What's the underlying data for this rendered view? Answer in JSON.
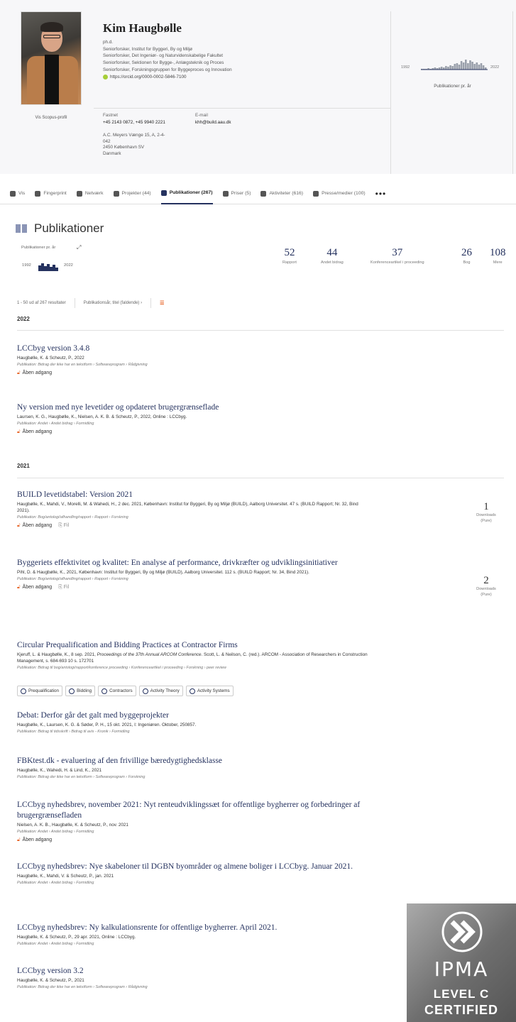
{
  "profile": {
    "name": "Kim Haugbølle",
    "degree": "ph.d.",
    "titles": [
      "Seniorforsker, Institut for Byggeri, By og Miljø",
      "Seniorforsker, Det Ingeniør- og Naturvidenskabelige Fakultet",
      "Seniorforsker, Sektionen for Bygge-, Anlægsteknik og Proces",
      "Seniorforsker, Forskningsgruppen for Byggeproces og Innovation"
    ],
    "orcid": "https://orcid.org/0000-0002-5846-7100",
    "scopus_link": "Vis Scopus-profil",
    "phone_label": "Fastnet",
    "phone_value": "+45 2143 0872, +45 9940 2221",
    "email_label": "E-mail",
    "email_value": "khh@build.aau.dk",
    "address": [
      "A.C. Meyers Vænge 15, A, 2-4-",
      "042",
      "2450 København SV",
      "Danmark"
    ],
    "chart_start": "1992",
    "chart_end": "2022",
    "chart_label": "Publikationer pr. år"
  },
  "tabs": [
    {
      "label": "Vis",
      "icon": "person-icon",
      "active": false
    },
    {
      "label": "Fingerprint",
      "icon": "fingerprint-icon",
      "active": false
    },
    {
      "label": "Netværk",
      "icon": "network-icon",
      "active": false
    },
    {
      "label": "Projekter (44)",
      "icon": "projects-icon",
      "active": false
    },
    {
      "label": "Publikationer (267)",
      "icon": "book-icon",
      "active": true
    },
    {
      "label": "Priser (5)",
      "icon": "trophy-icon",
      "active": false
    },
    {
      "label": "Aktiviteter (616)",
      "icon": "briefcase-icon",
      "active": false
    },
    {
      "label": "Presse/medier (100)",
      "icon": "newspaper-icon",
      "active": false
    }
  ],
  "tabs_more": "•••",
  "publications": {
    "heading": "Publikationer",
    "mini_label": "Publikationer pr. år",
    "mini_start": "1992",
    "mini_end": "2022",
    "stats": [
      {
        "n": "52",
        "label": "Rapport"
      },
      {
        "n": "44",
        "label": "Andet bidrag"
      },
      {
        "n": "37",
        "label": "Konferenceartikel i proceeding"
      },
      {
        "n": "26",
        "label": "Bog"
      },
      {
        "n": "108",
        "label": "Mere"
      }
    ],
    "results": "1 - 50 ud af 267 resultater",
    "sort": "Publikationsår, titel (faldende) ›",
    "rss": "RSS",
    "year_2022": "2022",
    "year_2021": "2021"
  },
  "items": [
    {
      "title": "LCCbyg version 3.4.8",
      "authors": "Haugbølle, K. & Scheutz, P., 2022",
      "category": "Publikation: Bidrag der ikke har en tekstform › Softwareprogram › Rådgivning",
      "access": "Åben adgang"
    },
    {
      "title": "Ny version med nye levetider og opdateret brugergrænseflade",
      "authors": "Laursen, K. G., Haugbølle, K., Nielsen, A. K. B. & Scheutz, P., 2022, Online : LCCbyg.",
      "category": "Publikation: Andet › Andet bidrag › Formidling",
      "access": "Åben adgang"
    },
    {
      "title": "BUILD levetidstabel: Version 2021",
      "authors": "Haugbølle, K., Mahdi, V., Morelli, M. & Wahedi, H., 2 dec. 2021, København: Institut for Byggeri, By og Miljø (BUILD), Aalborg Universitet. 47 s. (BUILD Rapport; Nr. 32, Bind 2021).",
      "category": "Publikation: Bog/antologi/afhandling/rapport › Rapport › Forskning",
      "access": "Åben adgang",
      "file": "Fil",
      "downloads": "1",
      "downloads_label": "Downloads",
      "downloads_src": "(Pure)"
    },
    {
      "title": "Byggeriets effektivitet og kvalitet: En analyse af performance, drivkræfter og udviklingsinitiativer",
      "authors": "Pihl, D. & Haugbølle, K., 2021, København: Institut for Byggeri, By og Miljø (BUILD), Aalborg Universitet. 112 s. (BUILD Rapport; Nr. 34, Bind 2021).",
      "category": "Publikation: Bog/antologi/afhandling/rapport › Rapport › Forskning",
      "access": "Åben adgang",
      "file": "Fil",
      "downloads": "2",
      "downloads_label": "Downloads",
      "downloads_src": "(Pure)"
    },
    {
      "title": "Circular Prequalification and Bidding Practices at Contractor Firms",
      "authors_a": "Kjeruff, L. & Haugbølle, K., 8 sep. 2021, ",
      "authors_i": "Proceedings of the 37th Annual ARCOM Conference",
      "authors_b": ". Scott, L. & Neilson, C. (red.). ARCOM - Association of Researchers in Construction Management, s. 684-693 10 s. 172701",
      "category": "Publikation: Bidrag til bog/antologi/rapport/konference proceeding › Konferenceartikel i proceeding › Forskning › peer review",
      "fingerprints": [
        "Prequalification",
        "Bidding",
        "Contractors",
        "Activity Theory",
        "Activity Systems"
      ]
    },
    {
      "title": "Debat: Derfor går det galt med byggeprojekter",
      "authors": "Haugbølle, K., Laursen, K. G. & Søder, P. H., 15 okt. 2021, I: Ingeniøren. Oktober, 250857.",
      "category": "Publikation: Bidrag til tidsskrift › Bidrag til avis - Kronik › Formidling"
    },
    {
      "title": "FBKtest.dk - evaluering af den frivillige bæredygtighedsklasse",
      "authors": "Haugbølle, K., Wahedi, H. & Lind, K., 2021",
      "category": "Publikation: Bidrag der ikke har en tekstform › Softwareprogram › Forskning"
    },
    {
      "title": "LCCbyg nyhedsbrev, november 2021: Nyt renteudviklingssæt for offentlige bygherrer og forbedringer af brugergrænsefladen",
      "authors": "Nielsen, A. K. B., Haugbølle, K. & Scheutz, P., nov. 2021",
      "category": "Publikation: Andet › Andet bidrag › Formidling",
      "access": "Åben adgang"
    },
    {
      "title": "LCCbyg nyhedsbrev: Nye skabeloner til DGBN byområder og almene boliger i LCCbyg. Januar 2021.",
      "authors": "Haugbølle, K., Mahdi, V. & Scheutz, P., jan. 2021",
      "category": "Publikation: Andet › Andet bidrag › Formidling"
    },
    {
      "title": "LCCbyg nyhedsbrev: Ny kalkulationsrente for offentlige bygherrer. April 2021.",
      "authors": "Haugbølle, K. & Scheutz, P., 29 apr. 2021, Online : LCCbyg.",
      "category": "Publikation: Andet › Andet bidrag › Formidling"
    },
    {
      "title": "LCCbyg version 3.2",
      "authors": "Haugbølle, K. & Scheutz, P., 2021",
      "category": "Publikation: Bidrag der ikke har en tekstform › Softwareprogram › Rådgivning"
    }
  ],
  "badge": {
    "brand": "IPMA",
    "level": "LEVEL C",
    "certified": "CERTIFIED"
  },
  "colors": {
    "accent": "#25325f",
    "open_access": "#e8692d",
    "orcid": "#a6ce39"
  }
}
